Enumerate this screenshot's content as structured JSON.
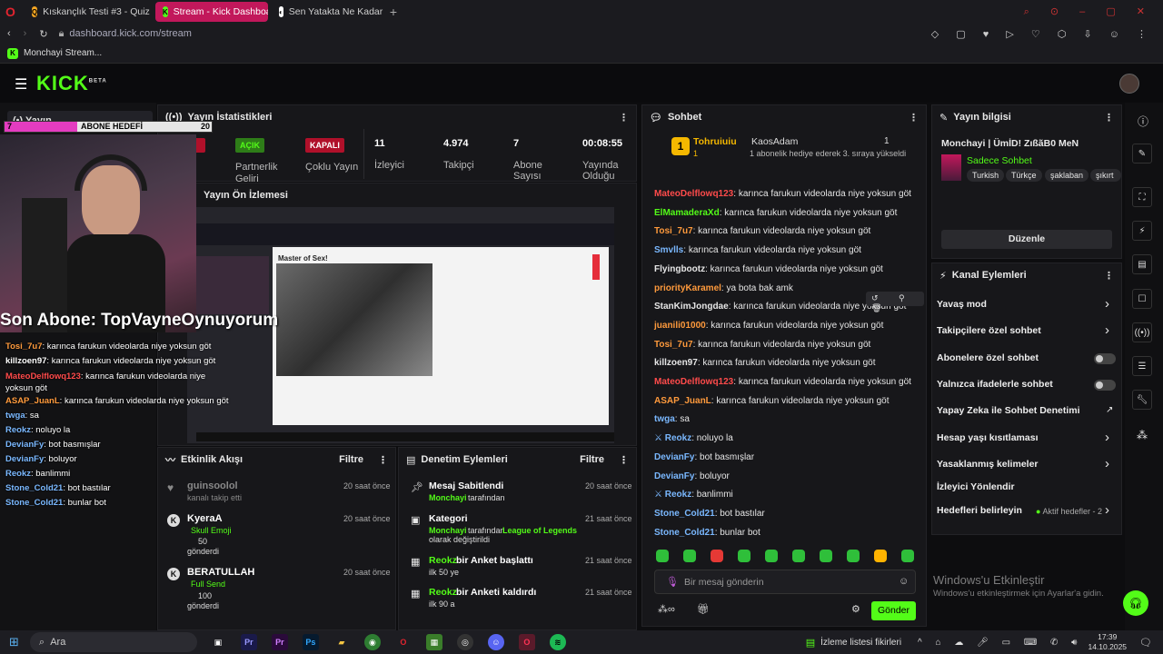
{
  "browser": {
    "tabs": [
      {
        "label": "Kıskançlık Testi #3 - Quiz"
      },
      {
        "label": "Stream - Kick Dashboard"
      },
      {
        "label": "Sen Yatakta Ne Kadar İyis"
      }
    ],
    "url": "dashboard.kick.com/stream",
    "bookmark": "Monchayi Stream..."
  },
  "header": {
    "logo": "KICK",
    "logo_sup": "BETA"
  },
  "left_nav": {
    "item": "Yayın"
  },
  "overlay": {
    "sub_goal_label": "ABONE HEDEFİ",
    "sub_goal_current": "7",
    "sub_goal_target": "20",
    "sub_goal_progress": 0.35,
    "last_sub": "Son Abone: TopVayneOynuyorum",
    "chat": [
      {
        "user": "Tosi_7u7",
        "color": "#ff9a3c",
        "msg": "karınca farukun videolarda niye yoksun göt"
      },
      {
        "user": "killzoen97",
        "color": "#ffffff",
        "msg": "karınca farukun videolarda niye yoksun göt"
      },
      {
        "user": "MateoDelflowq123",
        "color": "#ff4b4b",
        "msg": "karınca farukun videolarda niye yoksun göt"
      },
      {
        "user": "ASAP_JuanL",
        "color": "#ff9a3c",
        "msg": "karınca farukun videolarda niye yoksun göt"
      },
      {
        "user": "twga",
        "color": "#7ab8ff",
        "msg": "sa"
      },
      {
        "user": "Reokz",
        "color": "#7ab8ff",
        "msg": "noluyo la"
      },
      {
        "user": "DevianFy",
        "color": "#7ab8ff",
        "msg": "bot basmışlar"
      },
      {
        "user": "DevianFy",
        "color": "#7ab8ff",
        "msg": "boluyor"
      },
      {
        "user": "Reokz",
        "color": "#7ab8ff",
        "msg": "banlimmi"
      },
      {
        "user": "Stone_Cold21",
        "color": "#7ab8ff",
        "msg": "bot bastılar"
      },
      {
        "user": "Stone_Cold21",
        "color": "#7ab8ff",
        "msg": "bunlar bot"
      }
    ]
  },
  "stats": {
    "title": "Yayın İstatistikleri",
    "live_badge": "AÇIK",
    "partner_label": "Partnerlik Geliri",
    "off_badge": "KAPALI",
    "multi_label": "Çoklu Yayın",
    "viewers": "11",
    "viewers_label": "İzleyici",
    "followers": "4.974",
    "followers_label": "Takipçi",
    "subs": "7",
    "subs_label": "Abone Sayısı",
    "uptime": "00:08:55",
    "uptime_label": "Yayında Olduğu"
  },
  "preview": {
    "title": "Yayın Ön İzlemesi",
    "caption": "Master of Sex!"
  },
  "activity": {
    "title": "Etkinlik Akışı",
    "filter": "Filtre",
    "items": [
      {
        "user": "guinsoolol",
        "desc": "kanalı takip etti",
        "time": "20 saat önce"
      },
      {
        "user": "KyeraA",
        "sub": "Skull Emoji",
        "amount": "50",
        "desc": "gönderdi",
        "time": "20 saat önce"
      },
      {
        "user": "BERATULLAH",
        "sub": "Full Send",
        "amount": "100",
        "desc": "gönderdi",
        "time": "20 saat önce"
      }
    ]
  },
  "moderation": {
    "title": "Denetim Eylemleri",
    "filter": "Filtre",
    "items": [
      {
        "title": "Mesaj Sabitlendi",
        "line": "Monchayi",
        "line2": "tarafından",
        "time": "20 saat önce"
      },
      {
        "title": "Kategori",
        "line": "Monchayi",
        "line2": "tarafından",
        "extra": "League of Legends",
        "extra2": "olarak değiştirildi",
        "time": "21 saat önce"
      },
      {
        "title": "Reokz",
        "title2": "bir Anket başlattı",
        "line": "ilk 50 ye",
        "time": "21 saat önce"
      },
      {
        "title": "Reokz",
        "title2": "bir Anketi kaldırdı",
        "line": "ilk 90 a",
        "time": "21 saat önce"
      }
    ]
  },
  "chat": {
    "title": "Sohbet",
    "top1": {
      "rank": "1",
      "user": "Tohruiuiu",
      "count": "1"
    },
    "top2": {
      "user": "KaosAdam",
      "count": "1",
      "note": "1 abonelik hediye ederek 3. sıraya yükseldi"
    },
    "messages": [
      {
        "user": "MateoDelflowq123",
        "color": "#ff4b4b",
        "msg": "karınca farukun videolarda niye yoksun göt"
      },
      {
        "user": "ElMamaderaXd",
        "color": "#53fc18",
        "msg": "karınca farukun videolarda niye yoksun göt"
      },
      {
        "user": "Tosi_7u7",
        "color": "#ff9a3c",
        "msg": "karınca farukun videolarda niye yoksun göt"
      },
      {
        "user": "Smvlls",
        "color": "#7ab8ff",
        "msg": "karınca farukun videolarda niye yoksun göt"
      },
      {
        "user": "Flyingbootz",
        "color": "#e6e6e6",
        "msg": "karınca farukun videolarda niye yoksun göt"
      },
      {
        "user": "priorityKaramel",
        "color": "#ff9a3c",
        "msg": "ya bota bak amk"
      },
      {
        "user": "StanKimJongdae",
        "color": "#e6e6e6",
        "msg": "karınca farukun videolarda niye yoksun göt"
      },
      {
        "user": "juanili01000",
        "color": "#ff9a3c",
        "msg": "karınca farukun videolarda niye yoksun göt"
      },
      {
        "user": "Tosi_7u7",
        "color": "#ff9a3c",
        "msg": "karınca farukun videolarda niye yoksun göt"
      },
      {
        "user": "killzoen97",
        "color": "#e6e6e6",
        "msg": "karınca farukun videolarda niye yoksun göt"
      },
      {
        "user": "MateoDelflowq123",
        "color": "#ff4b4b",
        "msg": "karınca farukun videolarda niye yoksun göt"
      },
      {
        "user": "ASAP_JuanL",
        "color": "#ff9a3c",
        "msg": "karınca farukun videolarda niye yoksun göt"
      },
      {
        "user": "twga",
        "color": "#7ab8ff",
        "msg": "sa"
      },
      {
        "user": "Reokz",
        "color": "#7ab8ff",
        "msg": "noluyo la"
      },
      {
        "user": "DevianFy",
        "color": "#7ab8ff",
        "msg": "bot basmışlar"
      },
      {
        "user": "DevianFy",
        "color": "#7ab8ff",
        "msg": "boluyor"
      },
      {
        "user": "Reokz",
        "color": "#7ab8ff",
        "msg": "banlimmi"
      },
      {
        "user": "Stone_Cold21",
        "color": "#7ab8ff",
        "msg": "bot bastılar"
      },
      {
        "user": "Stone_Cold21",
        "color": "#7ab8ff",
        "msg": "bunlar bot"
      }
    ],
    "placeholder": "Bir mesaj gönderin",
    "send": "Gönder"
  },
  "info": {
    "title": "Yayın bilgisi",
    "stream_title": "Monchayi | ÜmİD! ZıßãB0 MeN",
    "category": "Sadece Sohbet",
    "tags": [
      "Turkish",
      "Türkçe",
      "şaklaban",
      "şıkırt"
    ],
    "edit": "Düzenle"
  },
  "actions": {
    "title": "Kanal Eylemleri",
    "items": [
      {
        "label": "Yavaş mod",
        "kind": "chev"
      },
      {
        "label": "Takipçilere özel sohbet",
        "kind": "chev"
      },
      {
        "label": "Abonelere özel sohbet",
        "kind": "toggle"
      },
      {
        "label": "Yalnızca ifadelerle sohbet",
        "kind": "toggle"
      },
      {
        "label": "Yapay Zeka ile Sohbet Denetimi",
        "kind": "ext"
      },
      {
        "label": "Hesap yaşı kısıtlaması",
        "kind": "chev"
      },
      {
        "label": "Yasaklanmış kelimeler",
        "kind": "chev"
      },
      {
        "label": "İzleyici Yönlendir",
        "kind": "none"
      },
      {
        "label": "Hedefleri belirleyin",
        "kind": "chev"
      }
    ],
    "goals_note": "Aktif hedefler - 2"
  },
  "watermark": {
    "line1": "Windows'u Etkinleştir",
    "line2": "Windows'u etkinleştirmek için Ayarlar'a gidin."
  },
  "taskbar": {
    "search": "Ara",
    "watchlist": "İzleme listesi fikirleri",
    "time": "17:39",
    "date": "14.10.2025"
  },
  "colors": {
    "kick_green": "#53fc18",
    "tab_active": "#c2185b"
  }
}
